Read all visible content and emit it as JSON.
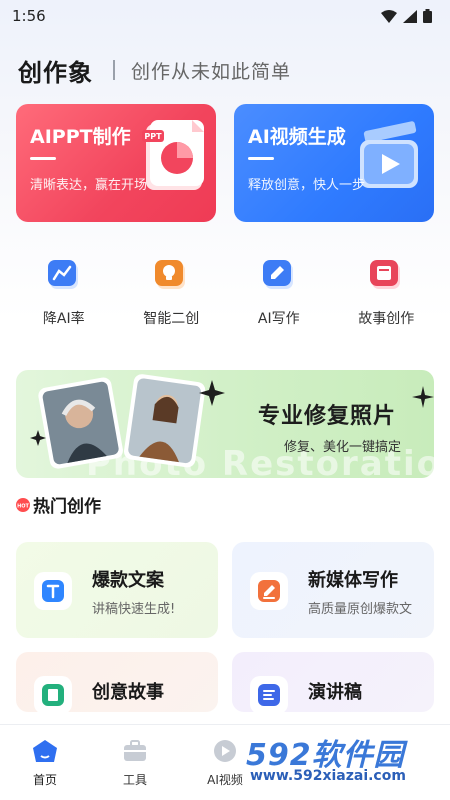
{
  "status_bar": {
    "time": "1:56"
  },
  "header": {
    "app_title": "创作象",
    "slogan": "创作从未如此简单"
  },
  "hero_cards": [
    {
      "title": "AIPPT制作",
      "subtitle": "清晰表达，赢在开场",
      "badge": "PPT",
      "color": "#f2455d"
    },
    {
      "title": "AI视频生成",
      "subtitle": "释放创意，快人一步",
      "color": "#2f7bff"
    }
  ],
  "quick_actions": [
    {
      "label": "降AI率",
      "icon": "chart-icon",
      "color": "#3d7cf5"
    },
    {
      "label": "智能二创",
      "icon": "bulb-icon",
      "color": "#f08a2c"
    },
    {
      "label": "AI写作",
      "icon": "pen-icon",
      "color": "#3d7cf5"
    },
    {
      "label": "故事创作",
      "icon": "book-icon",
      "color": "#e8455a"
    }
  ],
  "banner": {
    "title": "专业修复照片",
    "subtitle": "修复、美化一键搞定",
    "watermark": "Photo Restoration"
  },
  "section": {
    "title": "热门创作",
    "badge": "HOT"
  },
  "feature_cards": [
    {
      "title": "爆款文案",
      "desc": "讲稿快速生成!",
      "icon": "text-icon",
      "color": "#2f86ff"
    },
    {
      "title": "新媒体写作",
      "desc": "高质量原创爆款文",
      "icon": "edit-icon",
      "color": "#f2713c"
    },
    {
      "title": "创意故事",
      "desc": "",
      "icon": "story-icon",
      "color": "#23b07d"
    },
    {
      "title": "演讲稿",
      "desc": "",
      "icon": "speech-icon",
      "color": "#3e68e8"
    }
  ],
  "tabbar": {
    "tabs": [
      {
        "label": "首页",
        "active": true
      },
      {
        "label": "工具",
        "active": false
      },
      {
        "label": "AI视频",
        "active": false
      }
    ]
  },
  "watermark": {
    "brand": "592软件园",
    "url": "www.592xiazai.com"
  }
}
